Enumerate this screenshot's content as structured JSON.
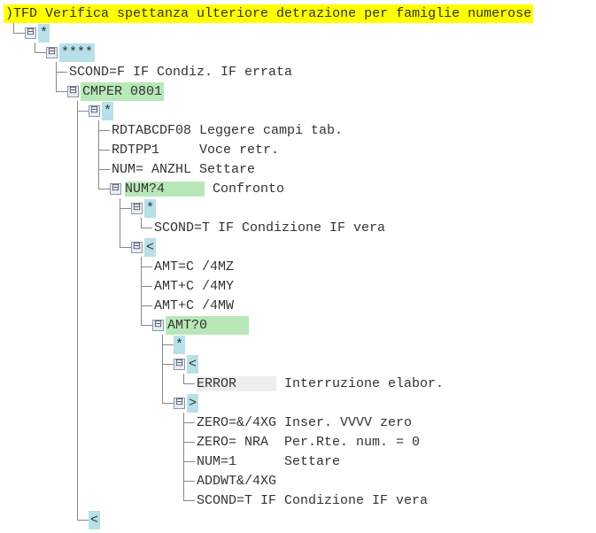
{
  "root": {
    "prefix": ")TFD ",
    "title": "Verifica spettanza ulteriore detrazione per famiglie numerose"
  },
  "n1": {
    "op": "*"
  },
  "n2": {
    "op": "****"
  },
  "n3": {
    "code": "SCOND=F",
    "desc": " IF Condiz. IF errata"
  },
  "n4": {
    "code": "CMPER 0801"
  },
  "n5": {
    "op": "*"
  },
  "n6": {
    "code": "RDTABCDF08",
    "desc": " Leggere campi tab."
  },
  "n7": {
    "code": "RDTPP1    ",
    "desc": " Voce retr."
  },
  "n8": {
    "code": "NUM= ANZHL",
    "desc": " Settare"
  },
  "n9": {
    "code": "NUM?4     ",
    "desc": " Confronto"
  },
  "n10": {
    "op": "*"
  },
  "n11": {
    "code": "SCOND=T",
    "desc": " IF Condizione IF vera"
  },
  "n12": {
    "op": "<"
  },
  "n13": {
    "code": "AMT=C /4MZ"
  },
  "n14": {
    "code": "AMT+C /4MY"
  },
  "n15": {
    "code": "AMT+C /4MW"
  },
  "n16": {
    "code": "AMT?0     "
  },
  "n17": {
    "op": "*"
  },
  "n18": {
    "op": "<"
  },
  "n19": {
    "code": "ERROR     ",
    "desc": " Interruzione elabor."
  },
  "n20": {
    "op": ">"
  },
  "n21": {
    "code": "ZERO=&/4XG",
    "desc": " Inser. VVVV zero"
  },
  "n22": {
    "code": "ZERO= NRA ",
    "desc": " Per.Rte. num. = 0"
  },
  "n23": {
    "code": "NUM=1     ",
    "desc": " Settare"
  },
  "n24": {
    "code": "ADDWT&/4XG"
  },
  "n25": {
    "code": "SCOND=T",
    "desc": " IF Condizione IF vera"
  },
  "n26": {
    "op": "<"
  }
}
